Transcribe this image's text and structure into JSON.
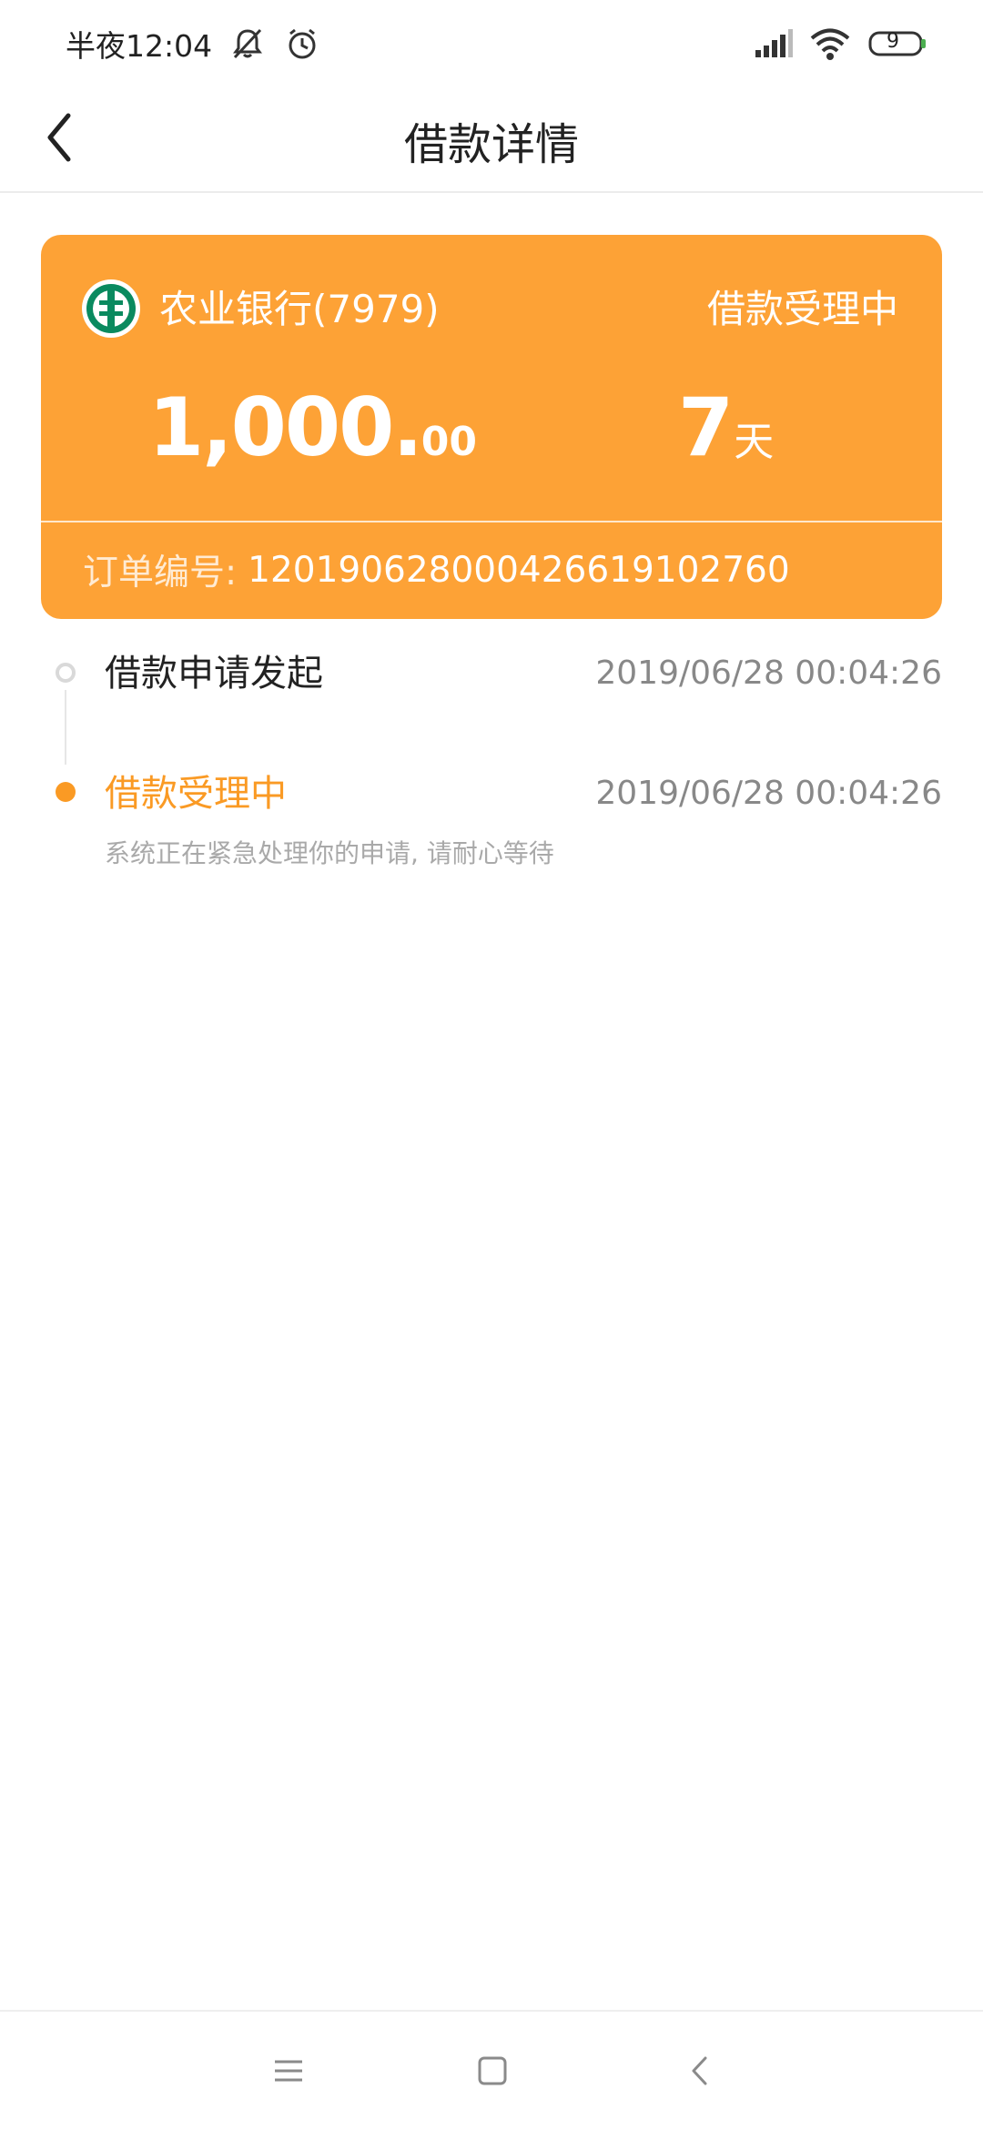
{
  "status_bar": {
    "time": "半夜12:04",
    "battery": "9",
    "icons": [
      "mute-bell-icon",
      "alarm-icon",
      "signal-icon",
      "wifi-icon",
      "battery-icon"
    ]
  },
  "header": {
    "title": "借款详情",
    "back_icon": "chevron-left-icon"
  },
  "loan_card": {
    "bank_name": "农业银行(7979)",
    "status": "借款受理中",
    "amount_int": "1,000.",
    "amount_dec": "00",
    "term_num": "7",
    "term_unit": "天",
    "order_label": "订单编号:",
    "order_number": "120190628000426619102760"
  },
  "timeline": [
    {
      "title": "借款申请发起",
      "time": "2019/06/28 00:04:26",
      "state": "done"
    },
    {
      "title": "借款受理中",
      "time": "2019/06/28 00:04:26",
      "state": "current",
      "description": "系统正在紧急处理你的申请, 请耐心等待"
    }
  ],
  "colors": {
    "accent": "#fa9a24",
    "card_bg": "#fda236",
    "bank_logo": "#0a8a5f"
  },
  "nav_bar": {
    "icons": [
      "menu-icon",
      "home-square-icon",
      "back-triangle-icon"
    ]
  }
}
